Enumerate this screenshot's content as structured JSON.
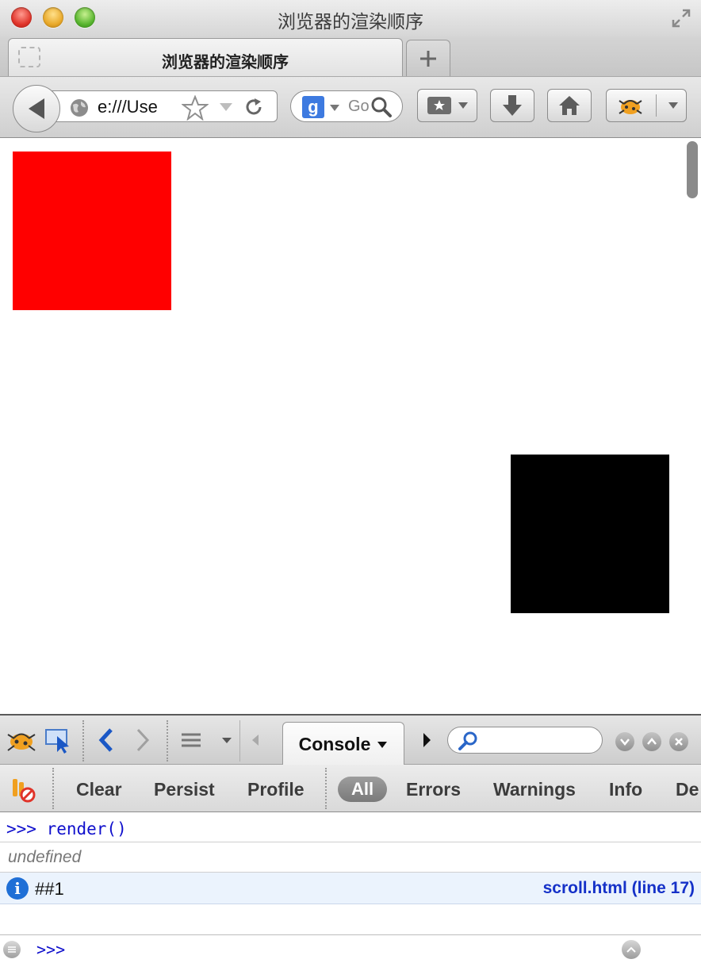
{
  "window": {
    "title": "浏览器的渲染顺序"
  },
  "tabs": [
    {
      "title": "浏览器的渲染顺序",
      "active": true
    }
  ],
  "toolbar": {
    "url_visible": "e:///Use",
    "search_engine": "g",
    "search_placeholder": "Go"
  },
  "page": {
    "boxes": [
      {
        "name": "red-box",
        "color": "#ff0000"
      },
      {
        "name": "black-box",
        "color": "#000000"
      }
    ]
  },
  "firebug": {
    "active_panel": "Console",
    "filters": {
      "clear": "Clear",
      "persist": "Persist",
      "profile": "Profile",
      "all": "All",
      "errors": "Errors",
      "warnings": "Warnings",
      "info": "Info",
      "debug": "De"
    },
    "log": {
      "command": ">>> render()",
      "result": "undefined",
      "info_message": "##1",
      "info_source": "scroll.html (line 17)"
    },
    "prompt": ">>>"
  },
  "colors": {
    "accent_blue": "#1f6fd6",
    "log_blue": "#0f0fcc",
    "info_row_bg": "#ebf3fd"
  }
}
